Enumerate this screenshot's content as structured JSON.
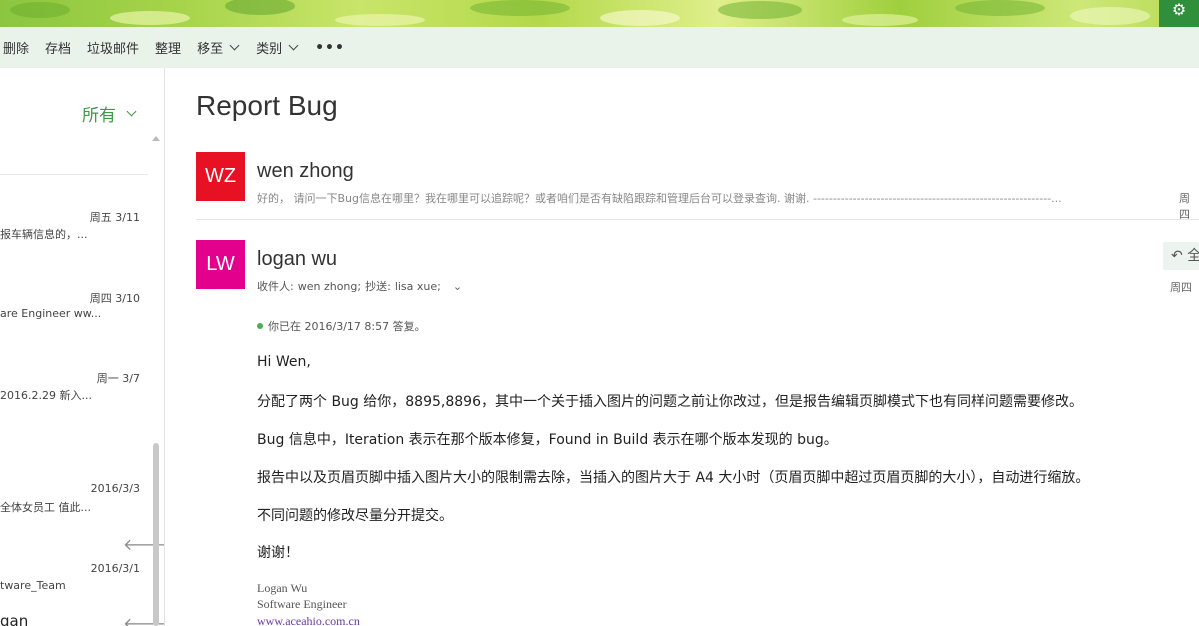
{
  "toolbar": {
    "delete": "删除",
    "archive": "存档",
    "junk": "垃圾邮件",
    "sweep": "整理",
    "move_to": "移至",
    "categories": "类别",
    "more": "•••",
    "settings_icon": "gear-icon"
  },
  "message_list": {
    "filter_label": "所有",
    "items": [
      {
        "date": "周五 3/11",
        "snippet": "报车辆信息的，..."
      },
      {
        "date": "周四 3/10",
        "snippet": "are Engineer ww..."
      },
      {
        "date": "周一 3/7",
        "snippet": "2016.2.29  新入..."
      },
      {
        "date": "2016/3/3",
        "snippet": "全体女员工  值此..."
      },
      {
        "date": "2016/3/1",
        "snippet": "tware_Team"
      }
    ],
    "cut_off_name": "gan"
  },
  "reading_pane": {
    "subject": "Report Bug",
    "thread": [
      {
        "initials": "WZ",
        "avatar_color": "#e81123",
        "sender": "wen zhong",
        "preview": "好的， 请问一下Bug信息在哪里？我在哪里可以追踪呢？或者咱们是否有缺陷跟踪和管理后台可以登录查询. 谢谢. ------------------------------------------------------------...",
        "day": "周四"
      },
      {
        "initials": "LW",
        "avatar_color": "#e3008c",
        "sender": "logan wu",
        "recipients_label": "收件人:",
        "to": "wen zhong;",
        "cc_label": "抄送:",
        "cc": "lisa xue;",
        "day": "周四",
        "reply_label": "全",
        "replied_note": "你已在 2016/3/17 8:57 答复。",
        "body": [
          "Hi Wen,",
          "分配了两个 Bug 给你，8895,8896，其中一个关于插入图片的问题之前让你改过，但是报告编辑页脚模式下也有同样问题需要修改。",
          "Bug 信息中，Iteration 表示在那个版本修复，Found in Build 表示在哪个版本发现的 bug。",
          "报告中以及页眉页脚中插入图片大小的限制需去除，当插入的图片大于 A4 大小时（页眉页脚中超过页眉页脚的大小），自动进行缩放。",
          "不同问题的修改尽量分开提交。",
          "谢谢！"
        ],
        "signature": {
          "name": "Logan Wu",
          "title": "Software Engineer",
          "website": "www.aceahio.com.cn"
        }
      }
    ]
  }
}
